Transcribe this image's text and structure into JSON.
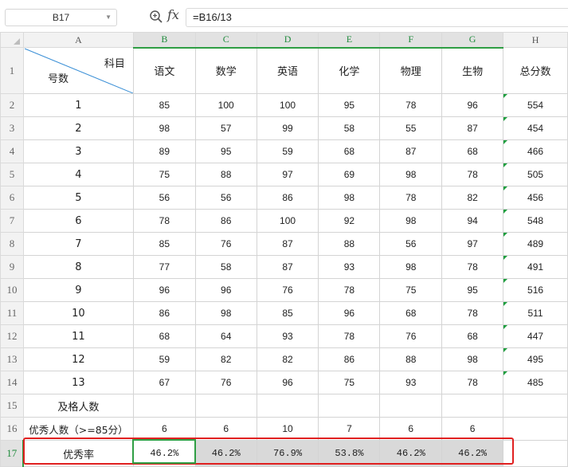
{
  "formula_bar": {
    "cell_ref": "B17",
    "fx_label": "fx",
    "formula": "=B16/13"
  },
  "sheet": {
    "columns": [
      "A",
      "B",
      "C",
      "D",
      "E",
      "F",
      "G",
      "H"
    ],
    "header_row": {
      "diagonal_top_right": "科目",
      "diagonal_bottom_left": "号数",
      "subjects": [
        "语文",
        "数学",
        "英语",
        "化学",
        "物理",
        "生物",
        "总分数"
      ]
    },
    "rows": [
      {
        "num": "2",
        "cells": [
          "1",
          "85",
          "100",
          "100",
          "95",
          "78",
          "96",
          "554"
        ]
      },
      {
        "num": "3",
        "cells": [
          "2",
          "98",
          "57",
          "99",
          "58",
          "55",
          "87",
          "454"
        ]
      },
      {
        "num": "4",
        "cells": [
          "3",
          "89",
          "95",
          "59",
          "68",
          "87",
          "68",
          "466"
        ]
      },
      {
        "num": "5",
        "cells": [
          "4",
          "75",
          "88",
          "97",
          "69",
          "98",
          "78",
          "505"
        ]
      },
      {
        "num": "6",
        "cells": [
          "5",
          "56",
          "56",
          "86",
          "98",
          "78",
          "82",
          "456"
        ]
      },
      {
        "num": "7",
        "cells": [
          "6",
          "78",
          "86",
          "100",
          "92",
          "98",
          "94",
          "548"
        ]
      },
      {
        "num": "8",
        "cells": [
          "7",
          "85",
          "76",
          "87",
          "88",
          "56",
          "97",
          "489"
        ]
      },
      {
        "num": "9",
        "cells": [
          "8",
          "77",
          "58",
          "87",
          "93",
          "98",
          "78",
          "491"
        ]
      },
      {
        "num": "10",
        "cells": [
          "9",
          "96",
          "96",
          "76",
          "78",
          "75",
          "95",
          "516"
        ]
      },
      {
        "num": "11",
        "cells": [
          "10",
          "86",
          "98",
          "85",
          "96",
          "68",
          "78",
          "511"
        ]
      },
      {
        "num": "12",
        "cells": [
          "11",
          "68",
          "64",
          "93",
          "78",
          "76",
          "68",
          "447"
        ]
      },
      {
        "num": "13",
        "cells": [
          "12",
          "59",
          "82",
          "82",
          "86",
          "88",
          "98",
          "495"
        ]
      },
      {
        "num": "14",
        "cells": [
          "13",
          "67",
          "76",
          "96",
          "75",
          "93",
          "78",
          "485"
        ]
      },
      {
        "num": "15",
        "cells": [
          "及格人数",
          "",
          "",
          "",
          "",
          "",
          "",
          ""
        ]
      },
      {
        "num": "16",
        "cells": [
          "优秀人数（>=85分）",
          "6",
          "6",
          "10",
          "7",
          "6",
          "6",
          ""
        ]
      },
      {
        "num": "17",
        "cells": [
          "优秀率",
          "46.2%",
          "46.2%",
          "76.9%",
          "53.8%",
          "46.2%",
          "46.2%",
          ""
        ]
      }
    ],
    "header_row_num": "1",
    "active_cell": "B17",
    "highlight_color": "#e02020",
    "selection_color": "#2f9e44"
  }
}
